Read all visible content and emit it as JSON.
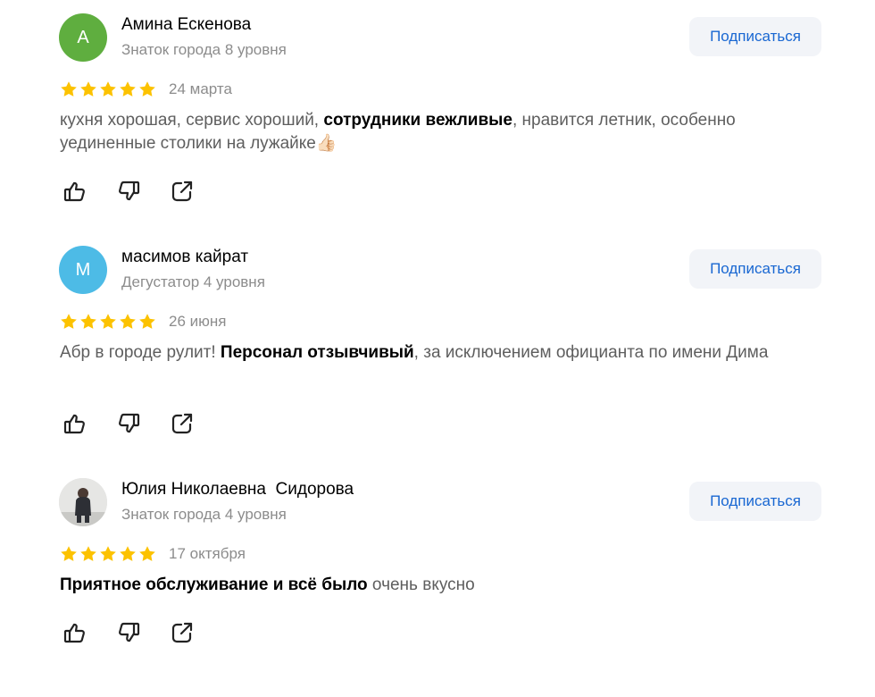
{
  "reviews": [
    {
      "avatar_letter": "А",
      "avatar_color": "#5fae3f",
      "name": "Амина Ескенова",
      "level": "Знаток города 8 уровня",
      "subscribe_label": "Подписаться",
      "rating": 5,
      "date": "24 марта",
      "text_parts": {
        "p1": "кухня хорошая, сервис хороший, ",
        "b1": "сотрудники вежливые",
        "p2": ", нравится летник, особенно уединенные столики на лужайке👍🏻"
      }
    },
    {
      "avatar_letter": "М",
      "avatar_color": "#4dbbe6",
      "name": "масимов кайрат",
      "level": "Дегустатор 4 уровня",
      "subscribe_label": "Подписаться",
      "rating": 5,
      "date": "26 июня",
      "text_parts": {
        "p1": "Абр в городе рулит! ",
        "b1": "Персонал отзывчивый",
        "p2": ", за исключением официанта по имени Дима"
      }
    },
    {
      "avatar_letter": "",
      "avatar_color": "#dcdcdc",
      "name": "Юлия Николаевна  Сидорова",
      "level": "Знаток города 4 уровня",
      "subscribe_label": "Подписаться",
      "rating": 5,
      "date": "17 октября",
      "text_parts": {
        "p1": "",
        "b1": "Приятное обслуживание и всё было",
        "p2": " очень вкусно"
      }
    }
  ],
  "icons": {
    "star": "star-icon",
    "like": "thumbs-up-icon",
    "dislike": "thumbs-down-icon",
    "share": "share-icon"
  },
  "colors": {
    "star": "#fcc200",
    "subscribe_text": "#1967d2",
    "subscribe_bg": "#f2f4f8",
    "muted_text": "#8c8c8c"
  }
}
